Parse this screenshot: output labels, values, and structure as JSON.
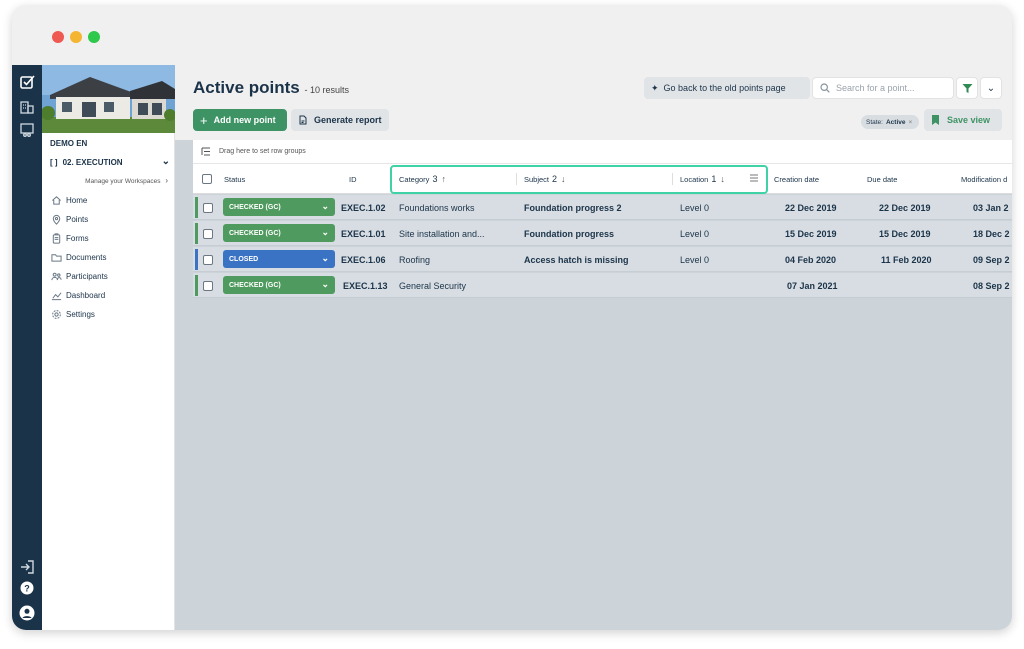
{
  "colors": {
    "rail": "#1b3349",
    "accent": "#3e9365",
    "checked": "#4f9a5e",
    "closed": "#3b73c4",
    "highlight": "#3fd2a7"
  },
  "sidebar": {
    "project_name": "DEMO EN",
    "workspace": "02. EXECUTION",
    "manage_label": "Manage your Workspaces",
    "items": [
      {
        "label": "Home",
        "icon": "home-icon"
      },
      {
        "label": "Points",
        "icon": "pin-icon"
      },
      {
        "label": "Forms",
        "icon": "clipboard-icon"
      },
      {
        "label": "Documents",
        "icon": "folder-icon"
      },
      {
        "label": "Participants",
        "icon": "people-icon"
      },
      {
        "label": "Dashboard",
        "icon": "chart-icon"
      },
      {
        "label": "Settings",
        "icon": "gear-icon"
      }
    ]
  },
  "header": {
    "title": "Active points",
    "results": "- 10 results",
    "old_page_label": "Go back to the old points page",
    "search_placeholder": "Search for a point...",
    "add_label": "Add new point",
    "report_label": "Generate report",
    "state_label": "State:",
    "state_value": "Active",
    "save_view_label": "Save view"
  },
  "grid": {
    "group_hint": "Drag here to set row groups",
    "columns": {
      "status": "Status",
      "id": "ID",
      "category": "Category",
      "category_order": "3",
      "subject": "Subject",
      "subject_order": "2",
      "location": "Location",
      "location_order": "1",
      "creation": "Creation date",
      "due": "Due date",
      "modification": "Modification d"
    },
    "rows": [
      {
        "status": "CHECKED (GC)",
        "id": "EXEC.1.02",
        "category": "Foundations works",
        "subject": "Foundation progress 2",
        "location": "Level 0",
        "creation": "22 Dec 2019",
        "due": "22 Dec 2019",
        "modification": "03 Jan 2"
      },
      {
        "status": "CHECKED (GC)",
        "id": "EXEC.1.01",
        "category": "Site installation and...",
        "subject": "Foundation progress",
        "location": "Level 0",
        "creation": "15 Dec 2019",
        "due": "15 Dec 2019",
        "modification": "18 Dec 2"
      },
      {
        "status": "CLOSED",
        "id": "EXEC.1.06",
        "category": "Roofing",
        "subject": "Access hatch is missing",
        "location": "Level 0",
        "creation": "04 Feb 2020",
        "due": "11 Feb 2020",
        "modification": "09 Sep 2"
      },
      {
        "status": "CHECKED (GC)",
        "id": "EXEC.1.13",
        "category": "General Security",
        "subject": "",
        "location": "",
        "creation": "07 Jan 2021",
        "due": "",
        "modification": "08 Sep 2"
      }
    ]
  }
}
